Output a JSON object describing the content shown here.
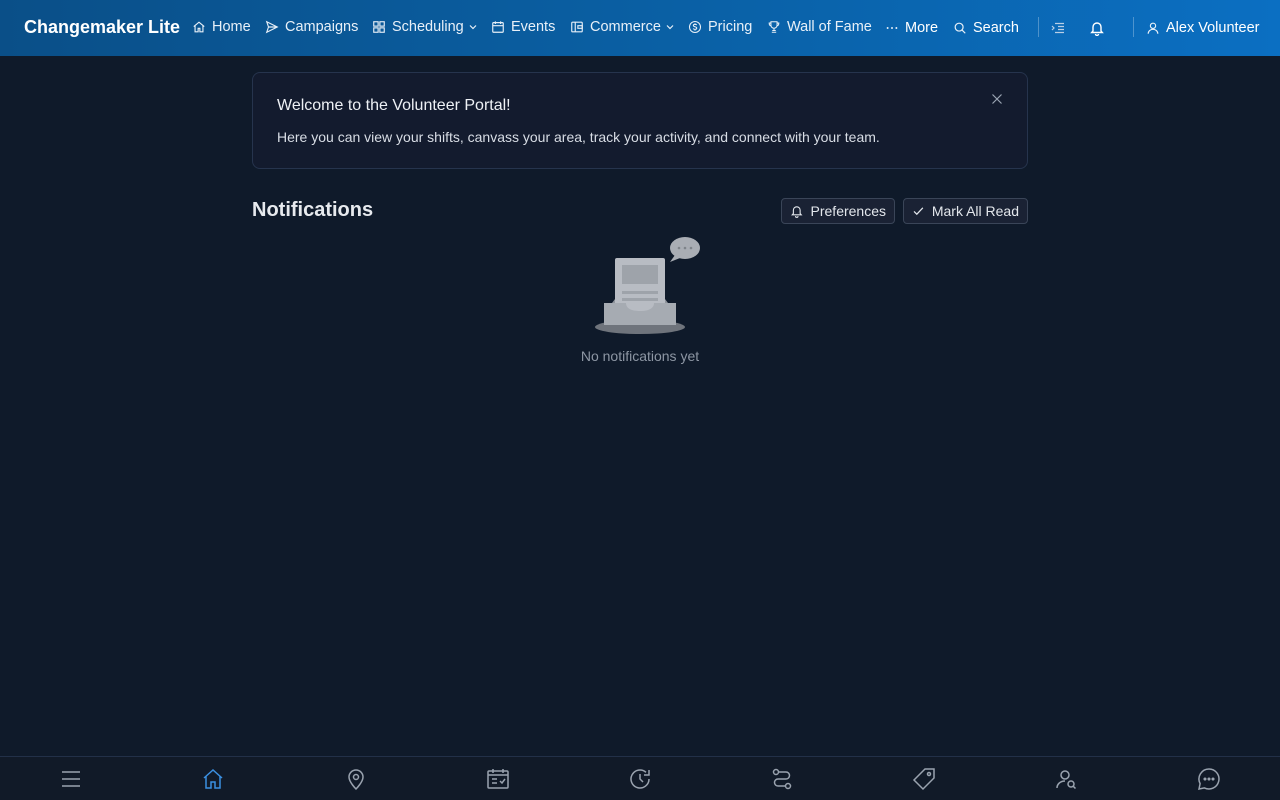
{
  "app": {
    "brand": "Changemaker Lite"
  },
  "nav": {
    "items": [
      {
        "label": "Home",
        "icon": "home-icon"
      },
      {
        "label": "Campaigns",
        "icon": "send-icon"
      },
      {
        "label": "Scheduling",
        "icon": "grid-icon",
        "has_dropdown": true
      },
      {
        "label": "Events",
        "icon": "calendar-icon"
      },
      {
        "label": "Commerce",
        "icon": "wallet-icon",
        "has_dropdown": true
      },
      {
        "label": "Pricing",
        "icon": "dollar-circle-icon"
      },
      {
        "label": "Wall of Fame",
        "icon": "trophy-icon"
      },
      {
        "label": "More",
        "icon": "ellipsis-icon"
      }
    ],
    "search_label": "Search",
    "user_name": "Alex Volunteer"
  },
  "welcome": {
    "title": "Welcome to the Volunteer Portal!",
    "body": "Here you can view your shifts, canvass your area, track your activity, and connect with your team."
  },
  "notifications": {
    "title": "Notifications",
    "preferences_label": "Preferences",
    "mark_all_read_label": "Mark All Read",
    "empty_text": "No notifications yet"
  },
  "bottom_nav": {
    "active": "home",
    "items": [
      "menu-icon",
      "home-icon",
      "map-pin-icon",
      "calendar-check-icon",
      "history-icon",
      "route-icon",
      "tag-icon",
      "user-search-icon",
      "chat-icon"
    ]
  },
  "colors": {
    "navbar_start": "#0a4f88",
    "navbar_end": "#0b6fc2",
    "background": "#0f1a2a",
    "active_accent": "#3b8fe0"
  }
}
